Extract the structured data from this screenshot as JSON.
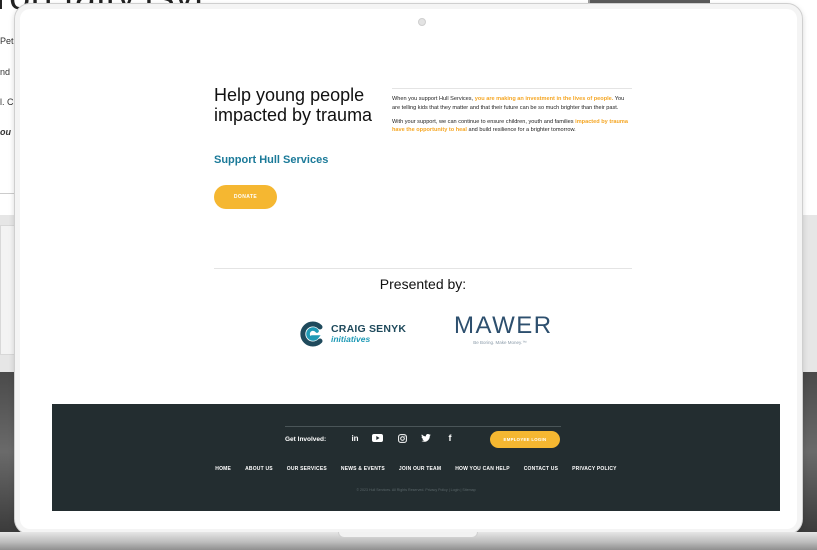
{
  "background_page": {
    "heading": "rori taity.tsvi",
    "lines": [
      "Pet",
      "nd",
      "l. C",
      "ou"
    ]
  },
  "hero": {
    "title": "Help young people impacted by trauma",
    "subtitle": "Support Hull Services",
    "donate_label": "DONATE",
    "para1_start": "When you support Hull Services, ",
    "para1_highlight": "you are making an investment in the lives of people.",
    "para1_end": " You are telling kids that they matter and that their future can be so much brighter than their past.",
    "para2_start": "With your support, we can continue to ensure children, youth and families ",
    "para2_highlight": "impacted by trauma have the opportunity to heal",
    "para2_end": " and build resilience for a brighter tomorrow."
  },
  "sponsors": {
    "heading": "Presented by:",
    "craig": {
      "name": "CRAIG SENYK",
      "sub": "initiatives",
      "icon": "craig-senyk-logo-icon"
    },
    "mawer": {
      "name": "MAWER",
      "tagline": "Be Boring. Make Money.™"
    }
  },
  "footer": {
    "get_involved": "Get Involved:",
    "social": [
      {
        "name": "linkedin-icon",
        "glyph": "in"
      },
      {
        "name": "youtube-icon",
        "glyph": "▶"
      },
      {
        "name": "instagram-icon",
        "glyph": "◎"
      },
      {
        "name": "twitter-icon",
        "glyph": "🐦"
      },
      {
        "name": "facebook-icon",
        "glyph": "f"
      }
    ],
    "employee_login": "EMPLOYEE LOGIN",
    "nav": [
      "HOME",
      "ABOUT US",
      "OUR SERVICES",
      "NEWS & EVENTS",
      "JOIN OUR TEAM",
      "HOW YOU CAN HELP",
      "CONTACT US",
      "PRIVACY POLICY"
    ],
    "copyright": "© 2023 Hull Services. All Rights Reserved. Privacy Policy | Login | Sitemap"
  },
  "colors": {
    "accent": "#f5b731",
    "highlight": "#f5a623",
    "link_blue": "#1b7a99",
    "footer_bg": "#232d30"
  }
}
